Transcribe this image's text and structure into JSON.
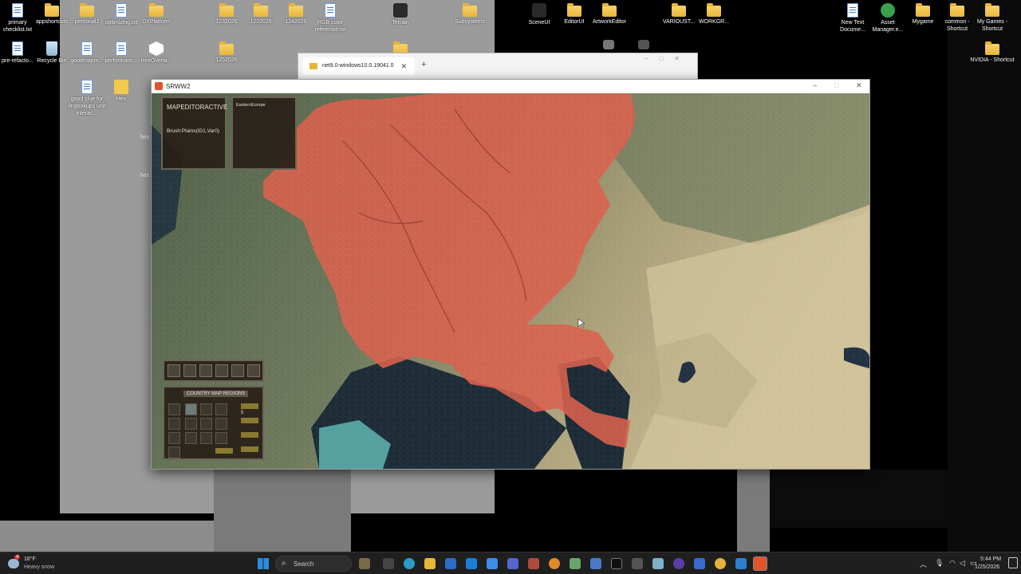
{
  "desktop": {
    "icons_left": [
      {
        "label": "primary checklist.txt",
        "icon": "doc"
      },
      {
        "label": "appshortcuts",
        "icon": "folder"
      },
      {
        "label": "personal2",
        "icon": "folder"
      },
      {
        "label": "optimizing.txt",
        "icon": "doc"
      },
      {
        "label": "DXPlatform",
        "icon": "folder"
      },
      {
        "label": "1232026",
        "icon": "folder"
      },
      {
        "label": "1222026",
        "icon": "folder"
      },
      {
        "label": "1242026",
        "icon": "folder"
      },
      {
        "label": "RGB color reference.txt",
        "icon": "doc"
      },
      {
        "label": "Terrain",
        "icon": "app"
      },
      {
        "label": "Subsystems",
        "icon": "folder"
      },
      {
        "label": "pre-refacto...",
        "icon": "doc"
      },
      {
        "label": "Recycle Bin",
        "icon": "bin"
      },
      {
        "label": "goodmapre...",
        "icon": "doc"
      },
      {
        "label": "performanc...",
        "icon": "doc"
      },
      {
        "label": "HexOverla...",
        "icon": "white"
      },
      {
        "label": "1252026",
        "icon": "folder"
      },
      {
        "label": "good clue for lingookups unit interac...",
        "icon": "doc"
      },
      {
        "label": "Hex",
        "icon": "doczip"
      }
    ],
    "icons_right": [
      {
        "label": "SceneUI",
        "icon": "app"
      },
      {
        "label": "EditorUI",
        "icon": "folder"
      },
      {
        "label": "ArtworkEditor",
        "icon": "folder"
      },
      {
        "label": "VARIOUST...",
        "icon": "folder"
      },
      {
        "label": "WORKGR...",
        "icon": "folder"
      },
      {
        "label": "New Text Docume...",
        "icon": "doc"
      },
      {
        "label": "Asset Manager.e...",
        "icon": "green"
      },
      {
        "label": "Mygame",
        "icon": "folder"
      },
      {
        "label": "common - Shortcut",
        "icon": "folder"
      },
      {
        "label": "My Games - Shortcut",
        "icon": "folder"
      },
      {
        "label": "NVIDIA - Shortcut",
        "icon": "folder"
      }
    ],
    "side_labels": [
      "hex",
      "hex"
    ]
  },
  "explorer": {
    "tab_label": "net9.0-windows10.0.19041.0"
  },
  "game": {
    "window_title": "SRWW2",
    "editor_status": "MAPEDITORACTIVE",
    "brush_label": "Brush:Plains(ID1,Var0)",
    "region_label": "EasternEurope",
    "panel_tabs": "COUNTRY  MAP REGIONS",
    "stepper_value": "5"
  },
  "taskbar": {
    "weather_temp": "18°F",
    "weather_desc": "Heavy snow",
    "weather_badge": "4",
    "search_placeholder": "Search",
    "time": "5:44 PM",
    "date": "1/25/2026"
  },
  "colors": {
    "country_fill": "#d9604c",
    "sea": "#1c2b36",
    "land_green": "#5e6c4f",
    "land_tan": "#b9a97f",
    "taskbar": "#1f1f1f"
  }
}
